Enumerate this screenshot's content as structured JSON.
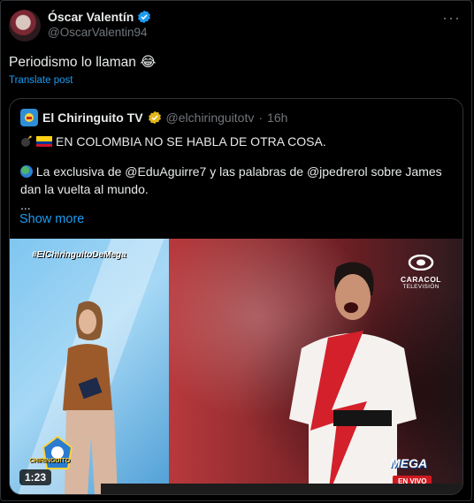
{
  "author": {
    "display_name": "Óscar Valentín",
    "handle": "@OscarValentin94",
    "more_icon": "more-horizontal-icon"
  },
  "post": {
    "text": "Periodismo lo llaman",
    "emoji": "😂",
    "translate_label": "Translate post"
  },
  "quote": {
    "display_name": "El Chiringuito TV",
    "handle": "@elchiringuitotv",
    "separator": "·",
    "time": "16h",
    "line1": "EN COLOMBIA NO SE HABLA DE OTRA COSA.",
    "line2": "La exclusiva de @EduAguirre7 y las palabras de @jpedrerol sobre James dan la vuelta al mundo.",
    "ellipsis": "...",
    "show_more": "Show more"
  },
  "video": {
    "hashtag": "#ElChiringuitoDeMega",
    "caracol_name": "CARACOL",
    "caracol_sub": "TELEVISIÓN",
    "chiringuito_label": "CHIRINGUITO",
    "mega_label": "MEGA",
    "live_badge": "EN VIVO",
    "timestamp": "1:23"
  },
  "colors": {
    "background": "#000000",
    "accent": "#1d9bf0",
    "muted": "#71767b",
    "verified_blue": "#1d9bf0",
    "verified_gold": "#e2b719"
  }
}
